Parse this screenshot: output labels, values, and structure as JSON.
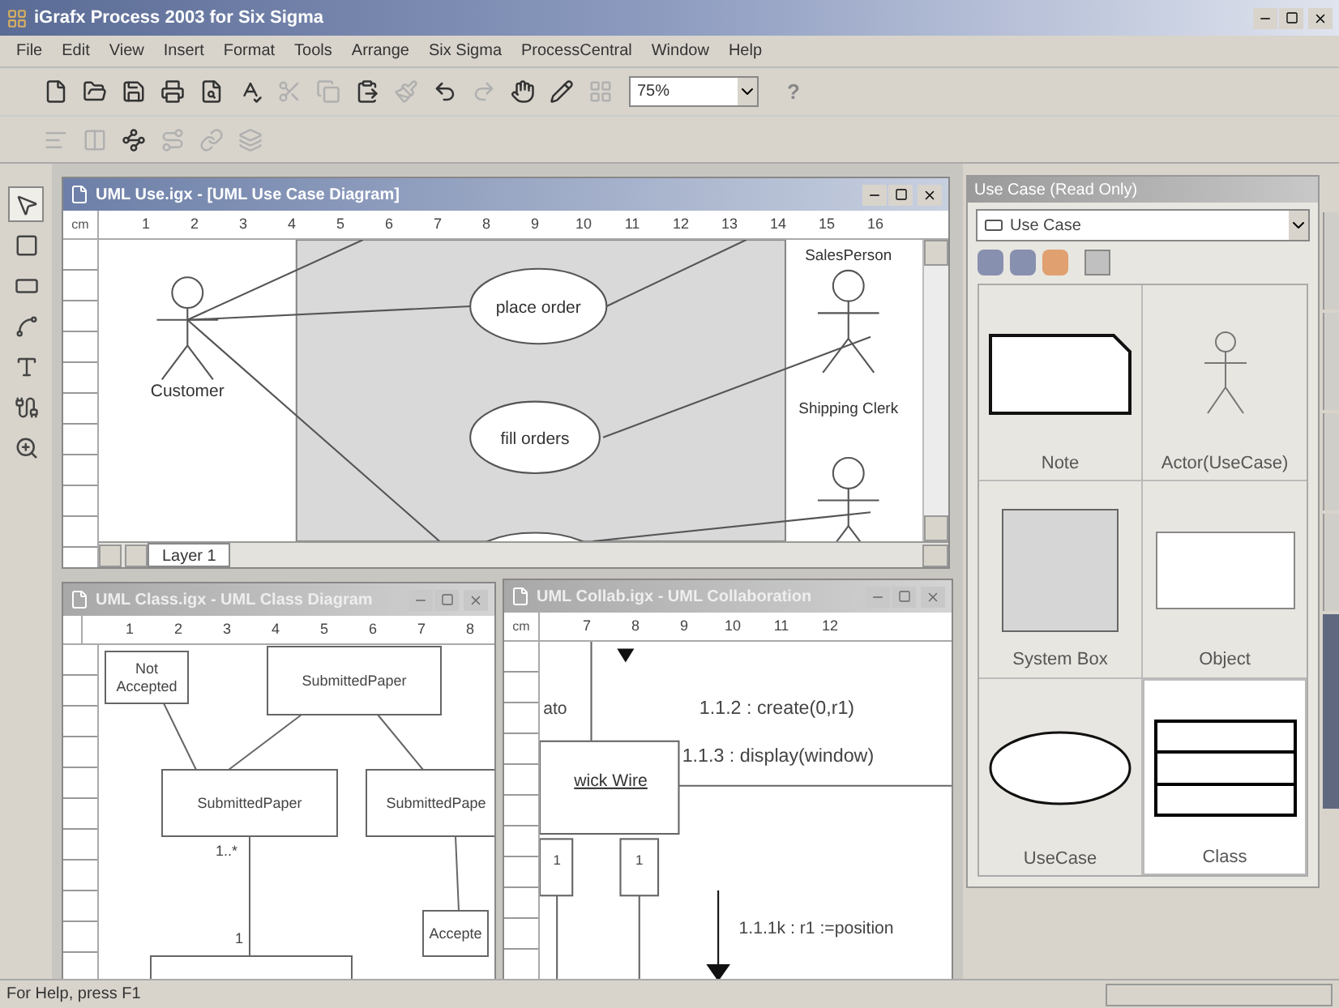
{
  "window": {
    "title": "iGrafx Process 2003 for Six Sigma"
  },
  "menu": [
    "File",
    "Edit",
    "View",
    "Insert",
    "Format",
    "Tools",
    "Arrange",
    "Six Sigma",
    "ProcessCentral",
    "Window",
    "Help"
  ],
  "toolbar": {
    "buttons": [
      {
        "kind": "new",
        "disabled": false
      },
      {
        "kind": "open",
        "disabled": false
      },
      {
        "kind": "save",
        "disabled": false
      },
      {
        "kind": "print",
        "disabled": false
      },
      {
        "kind": "preview",
        "disabled": false
      },
      {
        "kind": "spell",
        "disabled": false
      },
      {
        "kind": "cut",
        "disabled": true
      },
      {
        "kind": "copy",
        "disabled": true
      },
      {
        "kind": "paste",
        "disabled": false
      },
      {
        "kind": "brush",
        "disabled": true
      },
      {
        "kind": "undo",
        "disabled": false
      },
      {
        "kind": "redo",
        "disabled": true
      },
      {
        "kind": "hand",
        "disabled": false
      },
      {
        "kind": "pen",
        "disabled": false
      },
      {
        "kind": "grid",
        "disabled": true
      }
    ],
    "zoom": "75%",
    "help": "?"
  },
  "toolbar2": [
    {
      "kind": "align",
      "disabled": true
    },
    {
      "kind": "distribute",
      "disabled": true
    },
    {
      "kind": "connect",
      "disabled": false
    },
    {
      "kind": "route",
      "disabled": true
    },
    {
      "kind": "link",
      "disabled": true
    },
    {
      "kind": "layer",
      "disabled": true
    }
  ],
  "tools": [
    {
      "kind": "pointer",
      "selected": true
    },
    {
      "kind": "rect",
      "selected": false
    },
    {
      "kind": "box",
      "selected": false
    },
    {
      "kind": "line",
      "selected": false
    },
    {
      "kind": "text",
      "selected": false
    },
    {
      "kind": "connector",
      "selected": false
    },
    {
      "kind": "zoom",
      "selected": false
    }
  ],
  "use_case_window": {
    "title": "UML Use.igx - [UML Use Case Diagram]",
    "active": true,
    "units": "cm",
    "ruler": [
      "1",
      "2",
      "3",
      "4",
      "5",
      "6",
      "7",
      "8",
      "9",
      "10",
      "11",
      "12",
      "13",
      "14",
      "15",
      "16"
    ],
    "layer_tab": "Layer 1",
    "actors": [
      "Customer",
      "Shipping Clerk"
    ],
    "actor_top_label": "SalesPerson",
    "use_cases": [
      "place order",
      "fill orders"
    ]
  },
  "class_window": {
    "title": "UML Class.igx - UML Class Diagram",
    "active": false,
    "ruler": [
      "1",
      "2",
      "3",
      "4",
      "5",
      "6",
      "7",
      "8"
    ],
    "classes": [
      {
        "name": "Not\nAccepted"
      },
      {
        "name": "SubmittedPaper"
      },
      {
        "name": "SubmittedPaper"
      },
      {
        "name": "SubmittedPape"
      },
      {
        "name": "Accepte"
      }
    ],
    "multiplicities": [
      "1..*",
      "1"
    ]
  },
  "collab_window": {
    "title": "UML Collab.igx - UML Collaboration",
    "active": false,
    "units": "cm",
    "ruler": [
      "7",
      "8",
      "9",
      "10",
      "11",
      "12"
    ],
    "object": "wick Wire",
    "side_label": "ato",
    "messages": [
      "1.1.2 : create(0,r1)",
      "1.1.3 : display(window)",
      "1.1.1k : r1 :=position"
    ],
    "lifeline_marks": [
      "1",
      "1"
    ]
  },
  "palette": {
    "title": "Use Case (Read Only)",
    "stencil": "Use Case",
    "shapes": [
      {
        "kind": "note",
        "label": "Note",
        "selected": false
      },
      {
        "kind": "actor",
        "label": "Actor(UseCase)",
        "selected": false
      },
      {
        "kind": "systembox",
        "label": "System Box",
        "selected": false
      },
      {
        "kind": "object",
        "label": "Object",
        "selected": false
      },
      {
        "kind": "usecase",
        "label": "UseCase",
        "selected": false
      },
      {
        "kind": "class",
        "label": "Class",
        "selected": true
      }
    ]
  },
  "side_tabs": [
    {
      "selected": false
    },
    {
      "selected": false
    },
    {
      "selected": false
    },
    {
      "selected": false
    },
    {
      "selected": true
    }
  ],
  "status_bar": {
    "text": "For Help, press F1"
  }
}
